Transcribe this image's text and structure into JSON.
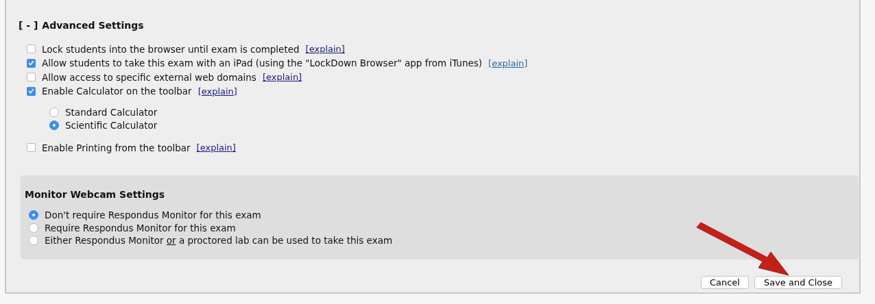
{
  "advanced": {
    "toggle": "[ - ]",
    "title": "Advanced Settings",
    "options": [
      {
        "label": "Lock students into the browser until exam is completed",
        "link": "[explain]",
        "checked": false,
        "link_visited": false
      },
      {
        "label": "Allow students to take this exam with an iPad (using the \"LockDown Browser\" app from iTunes)",
        "link": "[explain]",
        "checked": true,
        "link_visited": true
      },
      {
        "label": "Allow access to specific external web domains",
        "link": "[explain]",
        "checked": false,
        "link_visited": false
      },
      {
        "label": "Enable Calculator on the toolbar",
        "link": "[explain]",
        "checked": true,
        "link_visited": false,
        "children": [
          {
            "label": "Standard Calculator",
            "selected": false
          },
          {
            "label": "Scientific Calculator",
            "selected": true
          }
        ]
      },
      {
        "label": "Enable Printing from the toolbar",
        "link": "[explain]",
        "checked": false,
        "link_visited": false
      }
    ]
  },
  "monitor": {
    "title": "Monitor Webcam Settings",
    "options": [
      {
        "label": "Don't require Respondus Monitor for this exam",
        "selected": true
      },
      {
        "label": "Require Respondus Monitor for this exam",
        "selected": false
      },
      {
        "label": "Either Respondus Monitor ",
        "underlined": "or",
        "label_after": " a proctored lab can be used to take this exam",
        "selected": false
      }
    ]
  },
  "buttons": [
    "Cancel",
    "Save and Close"
  ]
}
